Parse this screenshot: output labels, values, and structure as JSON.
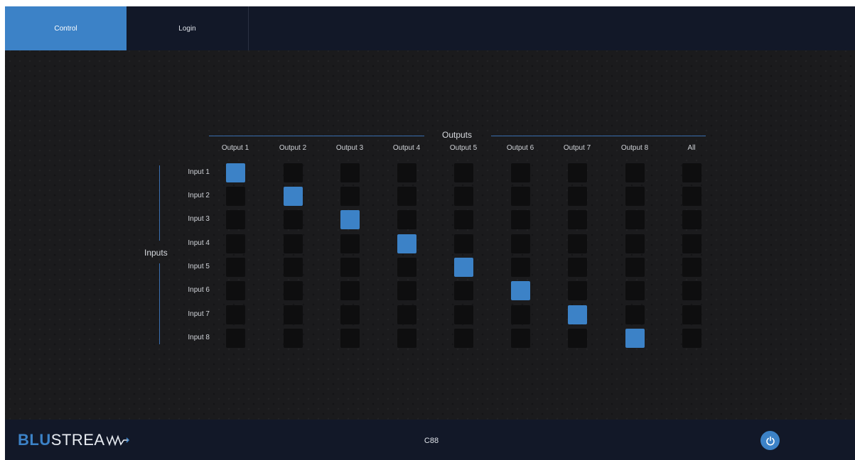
{
  "nav": {
    "tabs": [
      {
        "label": "Control",
        "active": true
      },
      {
        "label": "Login",
        "active": false
      }
    ]
  },
  "matrix": {
    "outputs_title": "Outputs",
    "inputs_title": "Inputs",
    "columns": [
      "Output 1",
      "Output 2",
      "Output 3",
      "Output 4",
      "Output 5",
      "Output 6",
      "Output 7",
      "Output 8",
      "All"
    ],
    "rows": [
      "Input 1",
      "Input 2",
      "Input 3",
      "Input 4",
      "Input 5",
      "Input 6",
      "Input 7",
      "Input 8"
    ],
    "routing": [
      [
        1,
        0,
        0,
        0,
        0,
        0,
        0,
        0,
        0
      ],
      [
        0,
        1,
        0,
        0,
        0,
        0,
        0,
        0,
        0
      ],
      [
        0,
        0,
        1,
        0,
        0,
        0,
        0,
        0,
        0
      ],
      [
        0,
        0,
        0,
        1,
        0,
        0,
        0,
        0,
        0
      ],
      [
        0,
        0,
        0,
        0,
        1,
        0,
        0,
        0,
        0
      ],
      [
        0,
        0,
        0,
        0,
        0,
        1,
        0,
        0,
        0
      ],
      [
        0,
        0,
        0,
        0,
        0,
        0,
        1,
        0,
        0
      ],
      [
        0,
        0,
        0,
        0,
        0,
        0,
        0,
        1,
        0
      ]
    ]
  },
  "footer": {
    "logo_blu": "BLU",
    "logo_stream": "STREA",
    "model": "C88",
    "power_icon": "power-icon"
  },
  "colors": {
    "accent": "#3c82c7",
    "nav_background": "#121828",
    "cell_off": "#0e0e0f"
  }
}
